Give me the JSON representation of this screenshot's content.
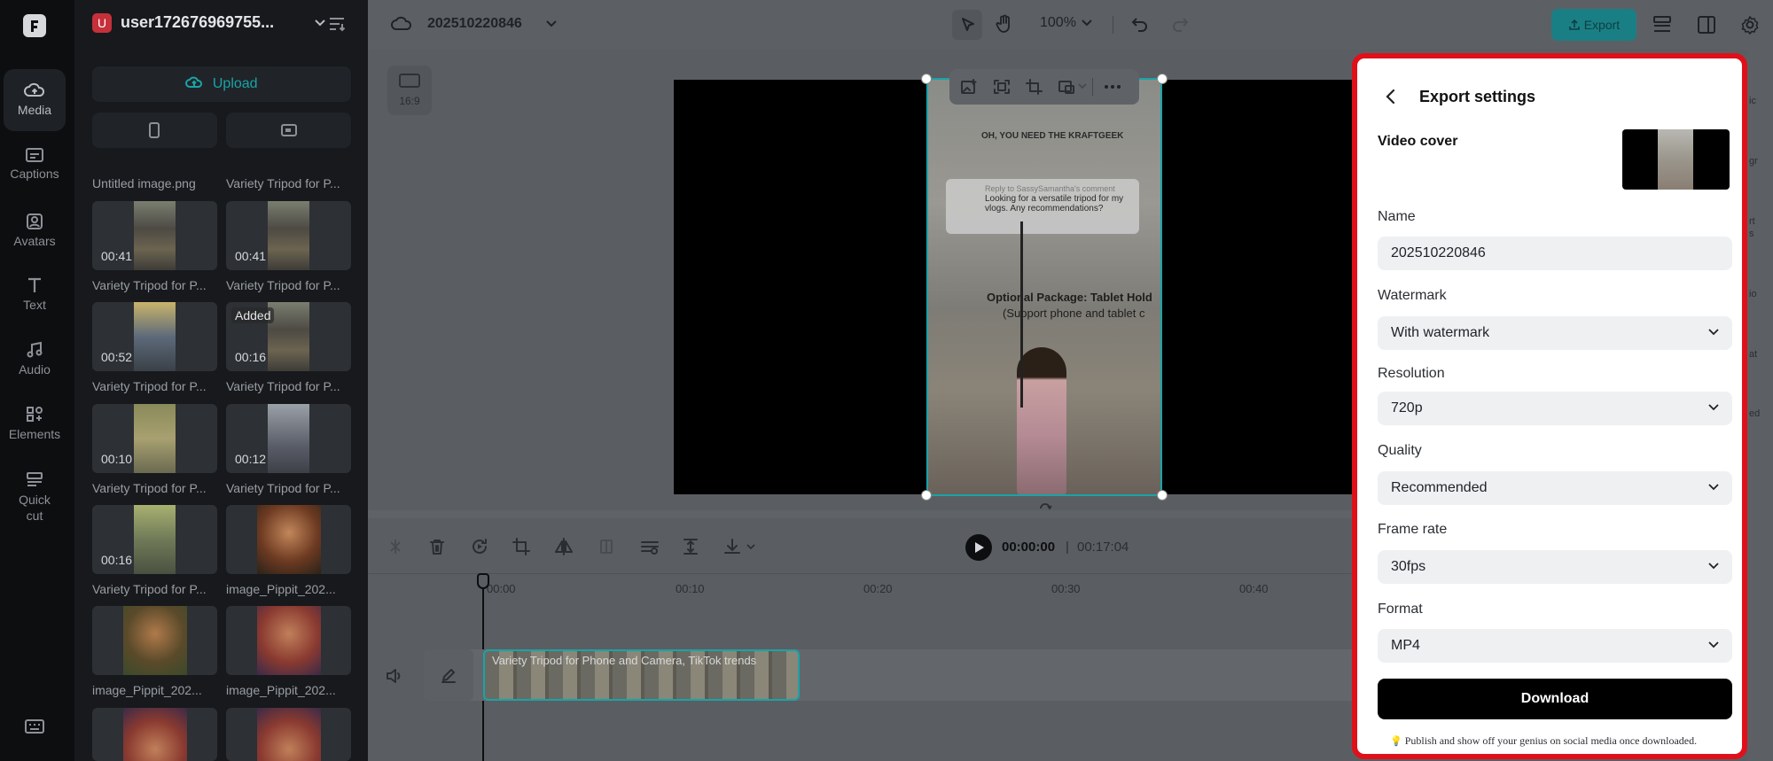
{
  "left_rail": {
    "items": [
      {
        "label": "Media",
        "icon": "media-icon"
      },
      {
        "label": "Captions",
        "icon": "captions-icon"
      },
      {
        "label": "Avatars",
        "icon": "avatars-icon"
      },
      {
        "label": "Text",
        "icon": "text-icon"
      },
      {
        "label": "Audio",
        "icon": "audio-icon"
      },
      {
        "label": "Elements",
        "icon": "elements-icon"
      },
      {
        "label": "Quick",
        "label2": "cut",
        "icon": "quick-cut-icon"
      }
    ]
  },
  "workspace": {
    "avatar_letter": "U",
    "user_name": "user172676969755...",
    "upload_label": "Upload"
  },
  "media_grid": {
    "captions": [
      "Untitled image.png",
      "Variety Tripod for P...",
      "Variety Tripod for P...",
      "Variety Tripod for P...",
      "Variety Tripod for P...",
      "Variety Tripod for P...",
      "Variety Tripod for P...",
      "Variety Tripod for P...",
      "Variety Tripod for P...",
      "image_Pippit_202...",
      "image_Pippit_202...",
      "image_Pippit_202..."
    ],
    "durations": [
      "00:41",
      "00:41",
      "00:52",
      "00:16",
      "00:10",
      "00:12",
      "00:16"
    ],
    "added_badge": "Added"
  },
  "topbar": {
    "project_name": "202510220846",
    "zoom": "100%",
    "export_label": "Export"
  },
  "canvas": {
    "aspect_label": "16:9",
    "video_overlay_top": "OH, YOU NEED THE KRAFTGEEK",
    "reply_header": "Reply to SassySamantha's comment",
    "reply_text": "Looking for a versatile tripod for my vlogs. Any recommendations?",
    "package_text": "Optional Package: Tablet Hold",
    "package_text2": "(Support phone and tablet c"
  },
  "player": {
    "current_time": "00:00:00",
    "separator": "|",
    "total_time": "00:17:04"
  },
  "timeline": {
    "ticks": [
      "00:00",
      "00:10",
      "00:20",
      "00:30",
      "00:40"
    ],
    "clip_title": "Variety Tripod for Phone and Camera, TikTok trends"
  },
  "export_settings": {
    "title": "Export settings",
    "video_cover_label": "Video cover",
    "name_label": "Name",
    "name_value": "202510220846",
    "watermark_label": "Watermark",
    "watermark_value": "With watermark",
    "resolution_label": "Resolution",
    "resolution_value": "720p",
    "quality_label": "Quality",
    "quality_value": "Recommended",
    "frame_rate_label": "Frame rate",
    "frame_rate_value": "30fps",
    "format_label": "Format",
    "format_value": "MP4",
    "download_label": "Download",
    "tip_icon": "💡",
    "tip_text": "Publish and show off your genius on social media once downloaded."
  },
  "right_rail_partial": [
    "ic",
    "gr",
    "rt",
    "s",
    "io",
    "at",
    "ed"
  ],
  "colors": {
    "accent": "#1aa3a8",
    "highlight_border": "#e0101a",
    "download_button": "#000000"
  }
}
